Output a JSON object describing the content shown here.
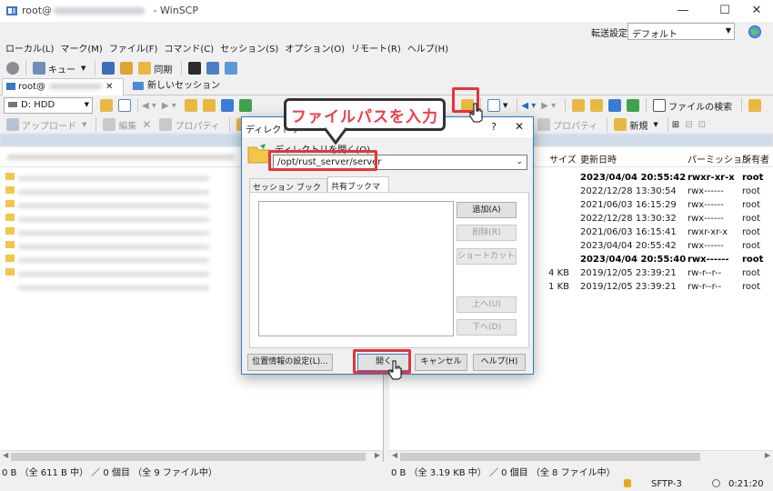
{
  "window": {
    "title_prefix": "root@",
    "title_suffix": " - WinSCP",
    "minimize": "—",
    "maximize": "☐",
    "close": "✕"
  },
  "transfer": {
    "label": "転送設定",
    "value": "デフォルト"
  },
  "menu": [
    "ローカル(L)",
    "マーク(M)",
    "ファイル(F)",
    "コマンド(C)",
    "セッション(S)",
    "オプション(O)",
    "リモート(R)",
    "ヘルプ(H)"
  ],
  "toolbar": {
    "queue_label": "キュー",
    "sync_label": "同期"
  },
  "tabs": {
    "session_label": "root@",
    "new_session_label": "新しいセッション"
  },
  "local": {
    "drive_label": "D: HDD",
    "upload_label": "アップロード",
    "edit_label": "編集",
    "properties_label": "プロパティ"
  },
  "remote": {
    "find_files_label": "ファイルの検索",
    "properties_label": "プロパティ",
    "new_label": "新規",
    "columns": [
      "サイズ",
      "更新日時",
      "パーミッション",
      "所有者"
    ],
    "rows": [
      {
        "size": "",
        "date": "2023/04/04 20:55:42",
        "perm": "rwxr-xr-x",
        "owner": "root",
        "bold": true
      },
      {
        "size": "",
        "date": "2022/12/28 13:30:54",
        "perm": "rwx------",
        "owner": "root",
        "bold": false
      },
      {
        "size": "",
        "date": "2021/06/03 16:15:29",
        "perm": "rwx------",
        "owner": "root",
        "bold": false
      },
      {
        "size": "",
        "date": "2022/12/28 13:30:32",
        "perm": "rwx------",
        "owner": "root",
        "bold": false
      },
      {
        "size": "",
        "date": "2021/06/03 16:15:41",
        "perm": "rwxr-xr-x",
        "owner": "root",
        "bold": false
      },
      {
        "size": "",
        "date": "2023/04/04 20:55:42",
        "perm": "rwx------",
        "owner": "root",
        "bold": false
      },
      {
        "size": "",
        "date": "2023/04/04 20:55:40",
        "perm": "rwx------",
        "owner": "root",
        "bold": true
      },
      {
        "size": "4 KB",
        "date": "2019/12/05 23:39:21",
        "perm": "rw-r--r--",
        "owner": "root",
        "bold": false
      },
      {
        "size": "1 KB",
        "date": "2019/12/05 23:39:21",
        "perm": "rw-r--r--",
        "owner": "root",
        "bold": false
      }
    ]
  },
  "status": {
    "left": "0 B （全 611 B 中） ／ 0 個目 （全 9 ファイル中）",
    "right": "0 B （全 3.19 KB 中） ／ 0 個目 （全 8 ファイル中）",
    "protocol": "SFTP-3",
    "time": "0:21:20"
  },
  "dialog": {
    "title": "ディレクトリ",
    "help_mark": "?",
    "close": "✕",
    "open_dir_label": "ディレクトリを開く(O)",
    "path_value": "/opt/rust_server/server",
    "tab_session_bookmarks": "セッション ブックマーク",
    "tab_shared_bookmarks": "共有ブックマーク",
    "add_button": "追加(A)",
    "delete_button": "削除(R)",
    "shortcut_button": "ショートカット(S)...",
    "up_button": "上へ(U)",
    "down_button": "下へ(D)",
    "location_button": "位置情報の設定(L)...",
    "open_button": "開く",
    "cancel_button": "キャンセル",
    "help_button": "ヘルプ(H)"
  },
  "callout": {
    "text": "ファイルパスを入力"
  },
  "colors": {
    "highlight": "#e3343e",
    "callout_text": "#e8414b",
    "folder": "#f3c54a",
    "dialog_border": "#2b7fc9"
  }
}
